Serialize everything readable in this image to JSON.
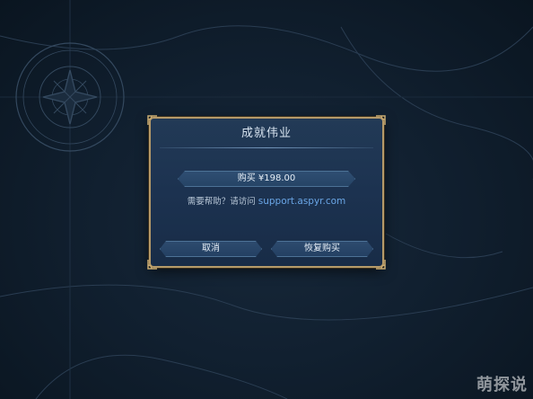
{
  "dialog": {
    "title": "成就伟业",
    "price_label": "购买 ¥198.00",
    "help_prefix": "需要帮助？请访问",
    "help_link": "support.aspyr.com",
    "cancel_label": "取消",
    "restore_label": "恢复购买"
  },
  "watermark": {
    "text": "萌探说"
  },
  "colors": {
    "dialog_border": "#b59a6a",
    "dialog_bg": "#1c3250",
    "button_bg": "#2f4e72",
    "link": "#6aa6e6",
    "background": "#0d1a26"
  },
  "icons": {
    "compass_rose": "compass-rose-icon",
    "corner_ornament": "gold-corner-ornament-icon"
  }
}
